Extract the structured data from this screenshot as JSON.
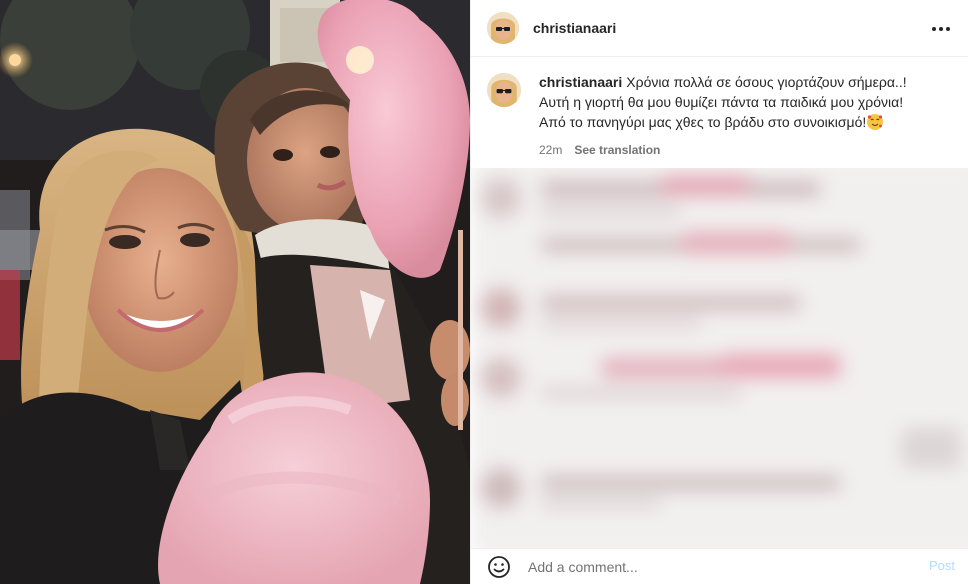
{
  "post": {
    "username": "christianaari",
    "caption_lines": [
      "Χρόνια πολλά σε όσους γιορτάζουν σήμερα..!",
      "Αυτή η γιορτή θα μου θυμίζει πάντα τα παιδικά μου χρόνια!",
      "Από το πανηγύρι μας χθες το βράδυ στο συνοικισμό!"
    ],
    "timestamp": "22m",
    "see_translation": "See translation"
  },
  "comment_box": {
    "placeholder": "Add a comment...",
    "post_label": "Post"
  },
  "icons": {
    "more": "more-options-icon",
    "emoji_picker": "smiley-icon",
    "caption_emoji": "smiling-face-with-hearts-icon"
  },
  "colors": {
    "text_primary": "#262626",
    "text_secondary": "#737373",
    "post_button_disabled": "#b3dbff",
    "divider": "#efefef"
  }
}
